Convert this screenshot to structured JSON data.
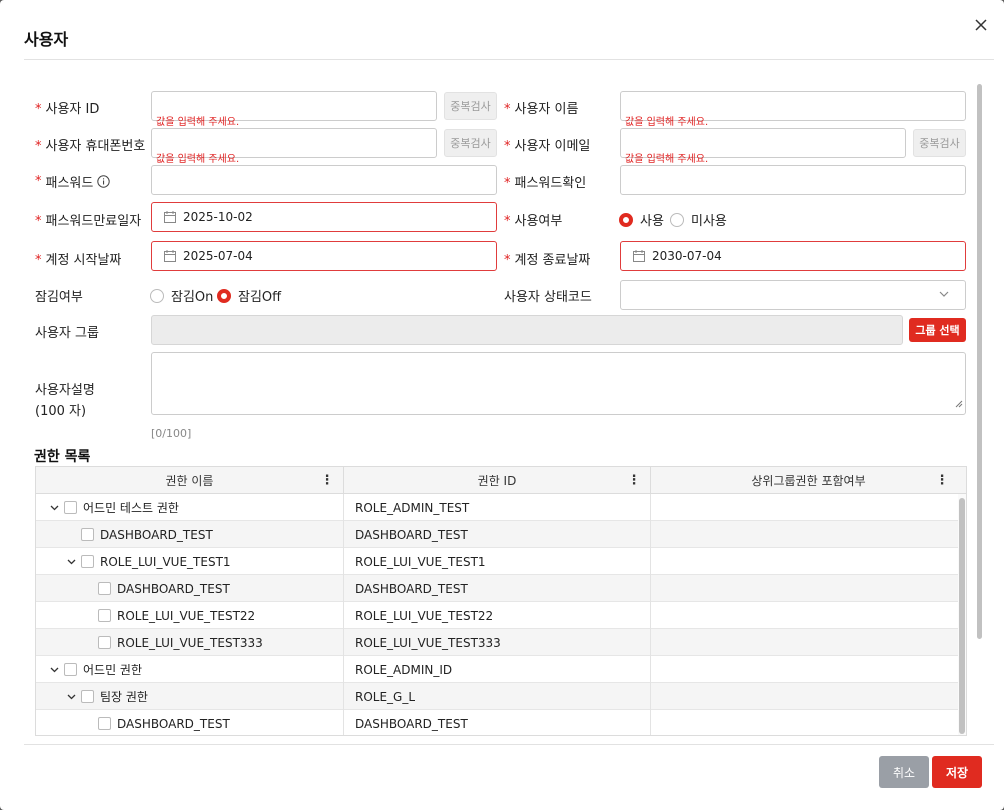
{
  "modal": {
    "title": "사용자"
  },
  "required_mark": "*",
  "validation_msg": "값을 입력해 주세요.",
  "dup_check_label": "중복검사",
  "fields": {
    "user_id": {
      "label": "사용자 ID",
      "value": ""
    },
    "user_name": {
      "label": "사용자 이름",
      "value": ""
    },
    "phone": {
      "label": "사용자 휴대폰번호",
      "value": ""
    },
    "email": {
      "label": "사용자 이메일",
      "value": ""
    },
    "password": {
      "label": "패스워드",
      "value": ""
    },
    "password_confirm": {
      "label": "패스워드확인",
      "value": ""
    },
    "password_expire": {
      "label": "패스워드만료일자",
      "value": "2025-10-02"
    },
    "use_yn": {
      "label": "사용여부",
      "options": [
        "사용",
        "미사용"
      ],
      "selected": "사용"
    },
    "account_start": {
      "label": "계정 시작날짜",
      "value": "2025-07-04"
    },
    "account_end": {
      "label": "계정 종료날짜",
      "value": "2030-07-04"
    },
    "lock_yn": {
      "label": "잠김여부",
      "options": [
        "잠김On",
        "잠김Off"
      ],
      "selected": "잠김Off"
    },
    "status_code": {
      "label": "사용자 상태코드",
      "value": ""
    },
    "user_group": {
      "label": "사용자 그룹",
      "value": "",
      "button": "그룹 선택"
    },
    "description": {
      "label_line1": "사용자설명",
      "label_line2": "(100 자)",
      "value": "",
      "counter": "[0/100]"
    }
  },
  "permissions": {
    "title": "권한 목록",
    "columns": [
      "권한 이름",
      "권한 ID",
      "상위그룹권한 포함여부"
    ],
    "rows": [
      {
        "name": "어드민 테스트 권한",
        "id": "ROLE_ADMIN_TEST",
        "level": 0,
        "expandable": true
      },
      {
        "name": "DASHBOARD_TEST",
        "id": "DASHBOARD_TEST",
        "level": 1,
        "expandable": false
      },
      {
        "name": "ROLE_LUI_VUE_TEST1",
        "id": "ROLE_LUI_VUE_TEST1",
        "level": 1,
        "expandable": true
      },
      {
        "name": "DASHBOARD_TEST",
        "id": "DASHBOARD_TEST",
        "level": 2,
        "expandable": false
      },
      {
        "name": "ROLE_LUI_VUE_TEST22",
        "id": "ROLE_LUI_VUE_TEST22",
        "level": 2,
        "expandable": false
      },
      {
        "name": "ROLE_LUI_VUE_TEST333",
        "id": "ROLE_LUI_VUE_TEST333",
        "level": 2,
        "expandable": false
      },
      {
        "name": "어드민 권한",
        "id": "ROLE_ADMIN_ID",
        "level": 0,
        "expandable": true
      },
      {
        "name": "팀장 권한",
        "id": "ROLE_G_L",
        "level": 1,
        "expandable": true
      },
      {
        "name": "DASHBOARD_TEST",
        "id": "DASHBOARD_TEST",
        "level": 2,
        "expandable": false
      }
    ]
  },
  "footer": {
    "cancel": "취소",
    "save": "저장"
  }
}
